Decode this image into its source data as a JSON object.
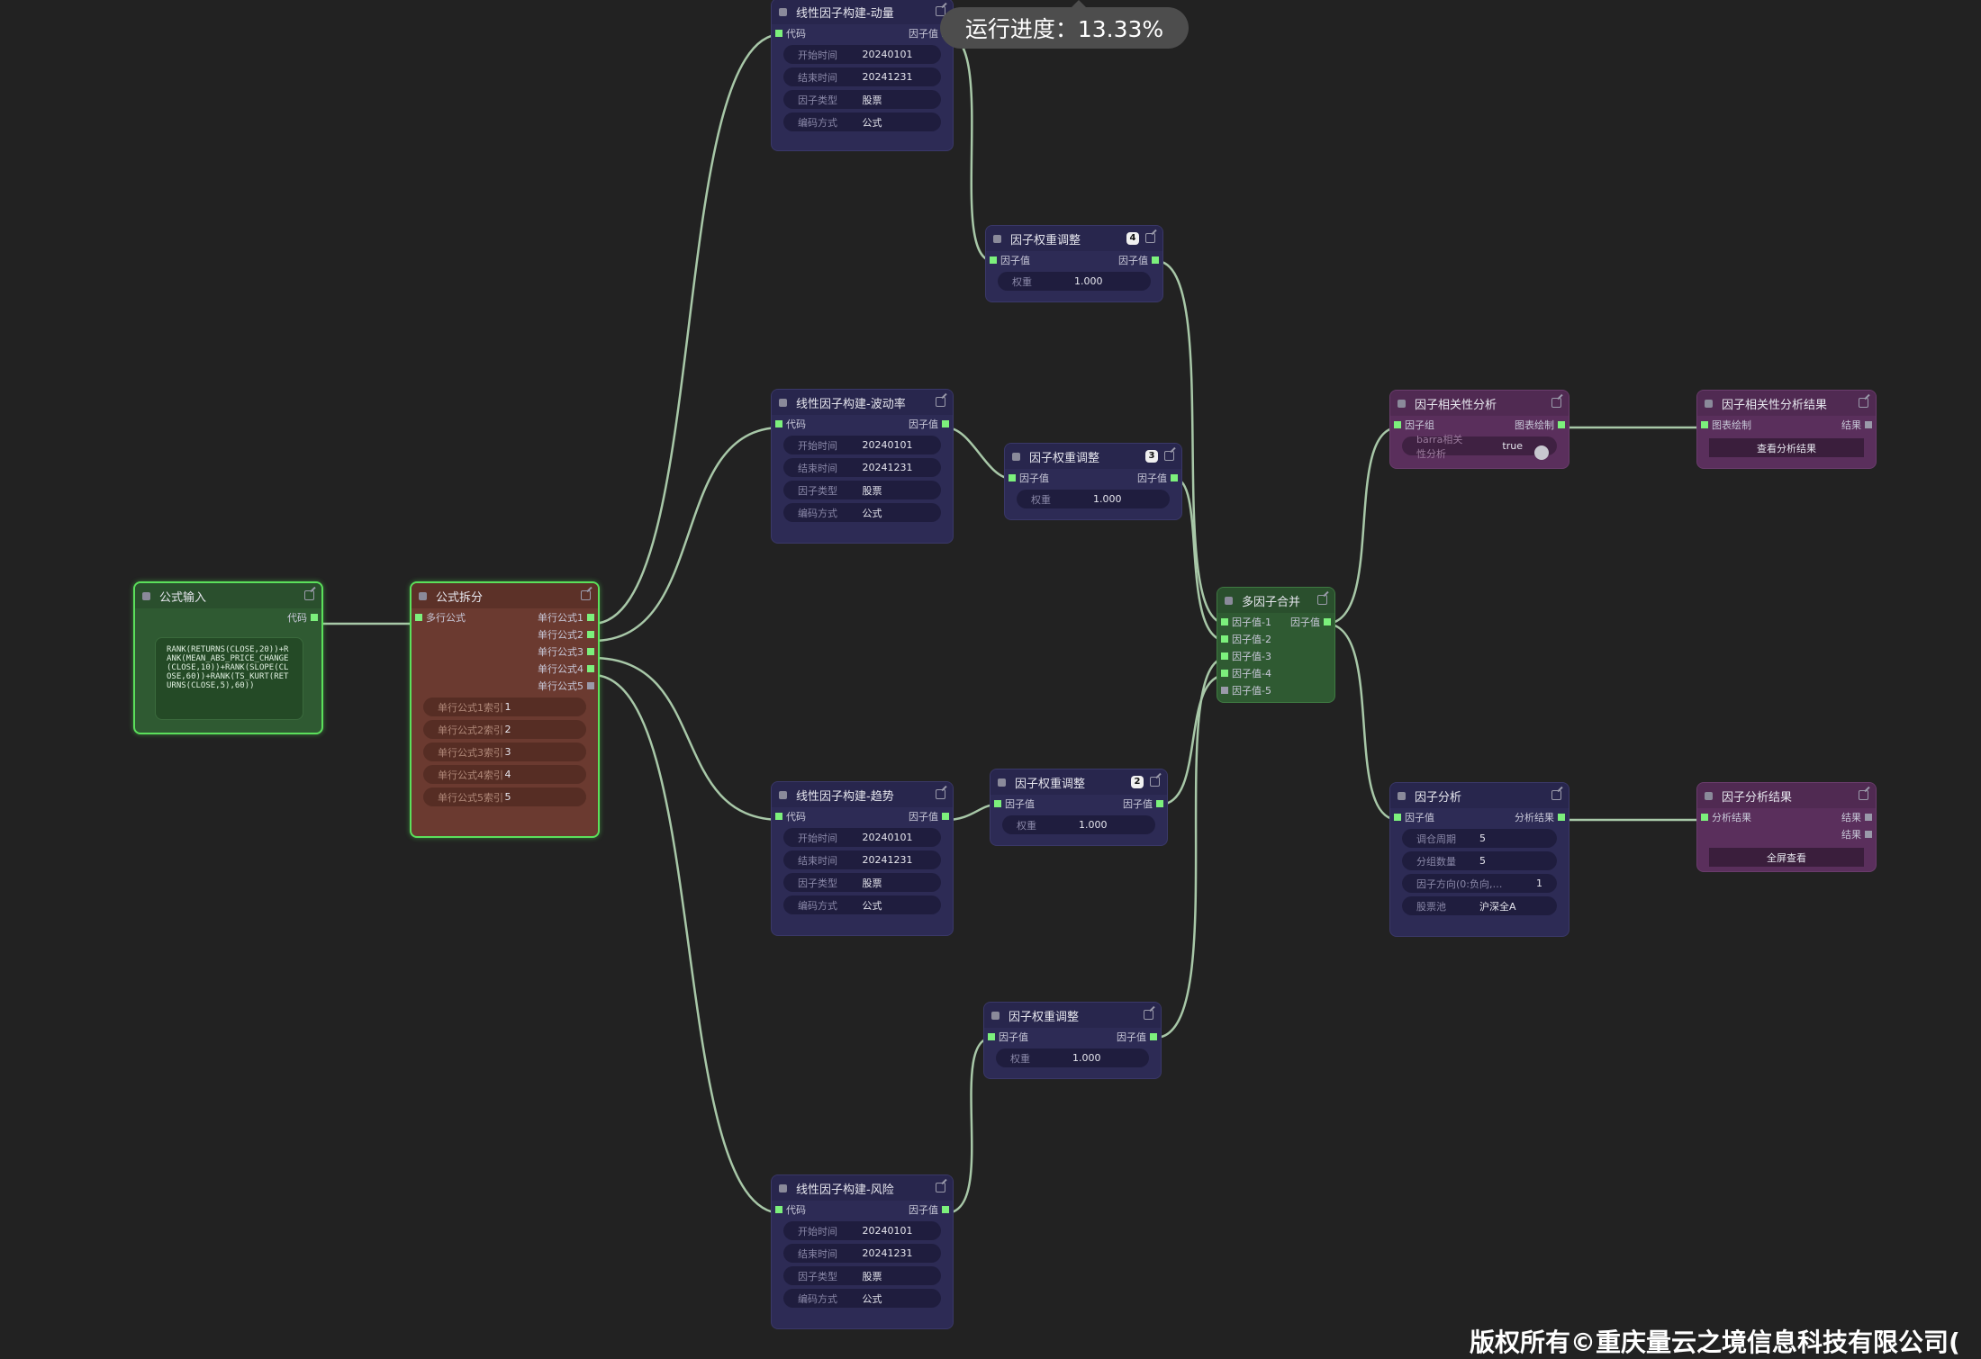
{
  "progress": {
    "label": "运行进度：13.33%",
    "value_percent": 13.33
  },
  "formula_input": {
    "title": "公式输入",
    "out": "代码",
    "code": "RANK(RETURNS(CLOSE,20))+RANK(MEAN_ABS_PRICE_CHANGE(CLOSE,10))+RANK(SLOPE(CLOSE,60))+RANK(TS_KURT(RETURNS(CLOSE,5),60))"
  },
  "formula_split": {
    "title": "公式拆分",
    "in": "多行公式",
    "outs": [
      "单行公式1",
      "单行公式2",
      "单行公式3",
      "单行公式4",
      "单行公式5"
    ],
    "widgets": [
      {
        "k": "单行公式1索引",
        "v": "1"
      },
      {
        "k": "单行公式2索引",
        "v": "2"
      },
      {
        "k": "单行公式3索引",
        "v": "3"
      },
      {
        "k": "单行公式4索引",
        "v": "4"
      },
      {
        "k": "单行公式5索引",
        "v": "5"
      }
    ]
  },
  "factor_nodes": [
    {
      "title": "线性因子构建-动量",
      "in": "代码",
      "out": "因子值",
      "widgets": [
        {
          "k": "开始时间",
          "v": "20240101"
        },
        {
          "k": "结束时间",
          "v": "20241231"
        },
        {
          "k": "因子类型",
          "v": "股票"
        },
        {
          "k": "编码方式",
          "v": "公式"
        }
      ]
    },
    {
      "title": "线性因子构建-波动率",
      "in": "代码",
      "out": "因子值",
      "widgets": [
        {
          "k": "开始时间",
          "v": "20240101"
        },
        {
          "k": "结束时间",
          "v": "20241231"
        },
        {
          "k": "因子类型",
          "v": "股票"
        },
        {
          "k": "编码方式",
          "v": "公式"
        }
      ]
    },
    {
      "title": "线性因子构建-趋势",
      "in": "代码",
      "out": "因子值",
      "widgets": [
        {
          "k": "开始时间",
          "v": "20240101"
        },
        {
          "k": "结束时间",
          "v": "20241231"
        },
        {
          "k": "因子类型",
          "v": "股票"
        },
        {
          "k": "编码方式",
          "v": "公式"
        }
      ]
    },
    {
      "title": "线性因子构建-风险",
      "in": "代码",
      "out": "因子值",
      "widgets": [
        {
          "k": "开始时间",
          "v": "20240101"
        },
        {
          "k": "结束时间",
          "v": "20241231"
        },
        {
          "k": "因子类型",
          "v": "股票"
        },
        {
          "k": "编码方式",
          "v": "公式"
        }
      ]
    }
  ],
  "weight_nodes": [
    {
      "title": "因子权重调整",
      "badge": "4",
      "in": "因子值",
      "out": "因子值",
      "k": "权重",
      "v": "1.000"
    },
    {
      "title": "因子权重调整",
      "badge": "3",
      "in": "因子值",
      "out": "因子值",
      "k": "权重",
      "v": "1.000"
    },
    {
      "title": "因子权重调整",
      "badge": "2",
      "in": "因子值",
      "out": "因子值",
      "k": "权重",
      "v": "1.000"
    },
    {
      "title": "因子权重调整",
      "badge": "",
      "in": "因子值",
      "out": "因子值",
      "k": "权重",
      "v": "1.000"
    }
  ],
  "merge": {
    "title": "多因子合并",
    "ins": [
      "因子值-1",
      "因子值-2",
      "因子值-3",
      "因子值-4",
      "因子值-5"
    ],
    "out": "因子值"
  },
  "corr": {
    "title": "因子相关性分析",
    "in": "因子组",
    "out": "图表绘制",
    "wk": "barra相关性分析",
    "wv": "true"
  },
  "corr_result": {
    "title": "因子相关性分析结果",
    "in": "图表绘制",
    "out": "结果",
    "button": "查看分析结果"
  },
  "analysis": {
    "title": "因子分析",
    "in": "因子值",
    "out": "分析结果",
    "widgets": [
      {
        "k": "调仓周期",
        "v": "5"
      },
      {
        "k": "分组数量",
        "v": "5"
      },
      {
        "k": "因子方向(0:负向,…",
        "v": "1"
      },
      {
        "k": "股票池",
        "v": "沪深全A"
      }
    ]
  },
  "analysis_result": {
    "title": "因子分析结果",
    "in": "分析结果",
    "outs": [
      "结果",
      "结果"
    ],
    "button": "全屏查看"
  },
  "copyright": "版权所有©重庆量云之境信息科技有限公司("
}
